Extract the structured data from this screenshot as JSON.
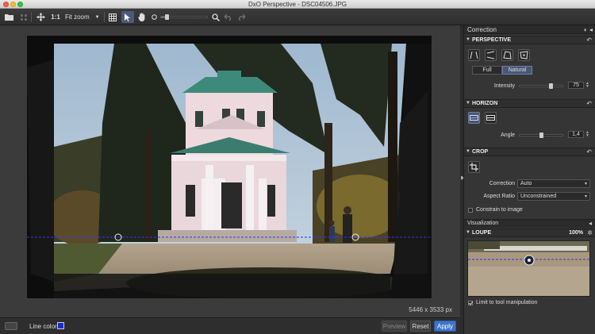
{
  "window": {
    "title": "DxO Perspective - DSC04506.JPG"
  },
  "toolbar": {
    "zoom_one_to_one": "1:1",
    "zoom_mode": "Fit zoom",
    "zoom_slider_fraction": 0.1
  },
  "canvas": {
    "image_size": "5446 x 3533 px"
  },
  "bottombar": {
    "line_color_label": "Line color",
    "line_color": "#1c2cd4",
    "preview_label": "Preview",
    "reset_label": "Reset",
    "apply_label": "Apply"
  },
  "panel": {
    "title": "Correction",
    "perspective": {
      "title": "PERSPECTIVE",
      "mode_full": "Full",
      "mode_natural": "Natural",
      "selected_mode": "Natural",
      "intensity_label": "Intensity",
      "intensity_value": "75",
      "intensity_fraction": 0.75
    },
    "horizon": {
      "title": "HORIZON",
      "angle_label": "Angle",
      "angle_value": "1,4",
      "angle_fraction": 0.52
    },
    "crop": {
      "title": "CROP",
      "correction_label": "Correction",
      "correction_value": "Auto",
      "aspect_label": "Aspect Ratio",
      "aspect_value": "Unconstrained",
      "constrain_label": "Constrain to image",
      "constrain_checked": false
    },
    "visualization": {
      "title": "Visualization"
    },
    "loupe": {
      "title": "LOUPE",
      "zoom": "100%",
      "limit_label": "Limit to tool manipulation",
      "limit_checked": true
    }
  },
  "colors": {
    "accent_blue": "#3f74c7",
    "selected_tool": "#475777",
    "horizon_line": "#3b35e0"
  }
}
